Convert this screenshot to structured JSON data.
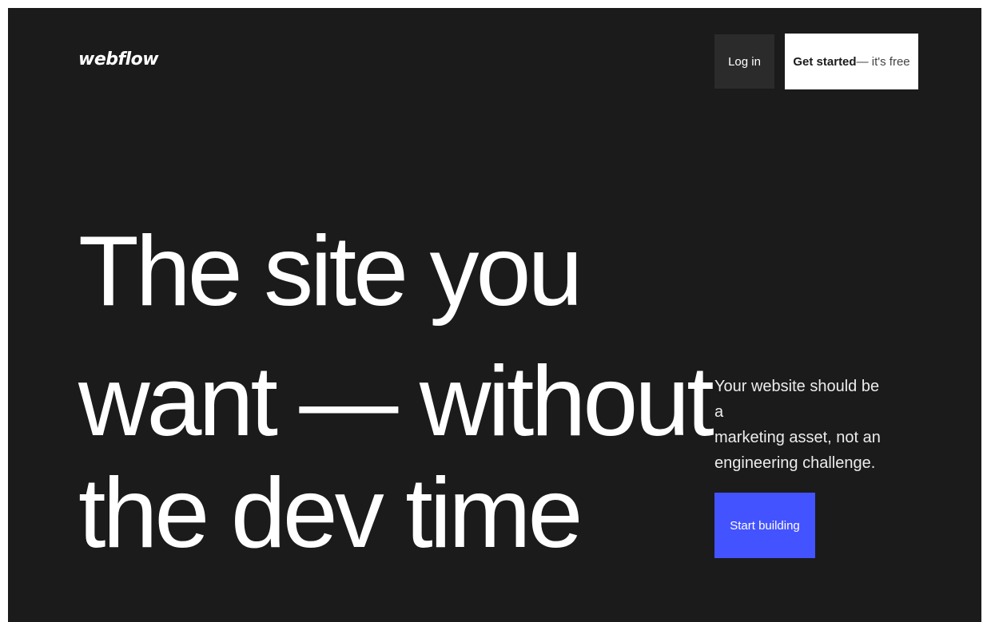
{
  "header": {
    "logo_text": "webflow",
    "login_label": "Log in",
    "cta_strong": "Get started",
    "cta_light": " — it's free"
  },
  "hero": {
    "headline_lines": [
      "The site you",
      "want — without",
      "the dev time"
    ],
    "subtext_lines": [
      "Your website should be a",
      "marketing asset, not an",
      "engineering challenge."
    ],
    "start_button_label": "Start building"
  },
  "colors": {
    "background": "#1b1b1b",
    "login_button_bg": "#2b2b2b",
    "cta_button_bg": "#ffffff",
    "accent": "#4353ff"
  }
}
